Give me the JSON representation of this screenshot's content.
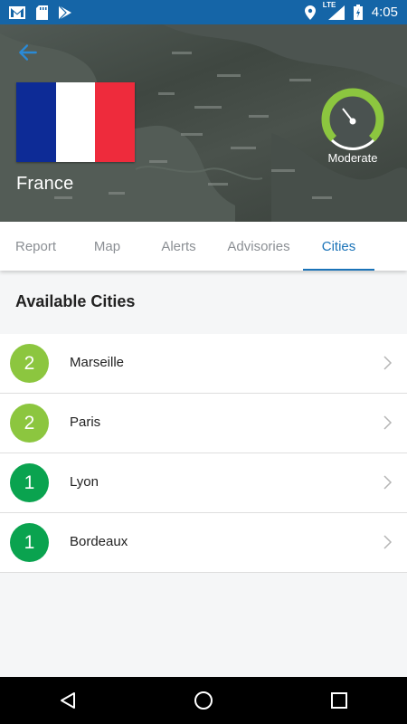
{
  "status_bar": {
    "time": "4:05",
    "network": "LTE",
    "icons": [
      "gmail-icon",
      "sd-card-icon",
      "play-store-icon",
      "location-icon",
      "signal-icon",
      "battery-icon"
    ]
  },
  "header": {
    "country": "France",
    "flag_colors": [
      "#0d2b96",
      "#ffffff",
      "#ee2b3c"
    ],
    "air_quality_label": "Moderate",
    "gauge_color": "#8cc63f"
  },
  "tabs": [
    {
      "label": "Report",
      "active": false
    },
    {
      "label": "Map",
      "active": false
    },
    {
      "label": "Alerts",
      "active": false
    },
    {
      "label": "Advisories",
      "active": false
    },
    {
      "label": "Cities",
      "active": true
    }
  ],
  "section": {
    "title": "Available Cities"
  },
  "cities": [
    {
      "score": "2",
      "name": "Marseille",
      "color": "#8cc63f"
    },
    {
      "score": "2",
      "name": "Paris",
      "color": "#8cc63f"
    },
    {
      "score": "1",
      "name": "Lyon",
      "color": "#0aa34f"
    },
    {
      "score": "1",
      "name": "Bordeaux",
      "color": "#0aa34f"
    }
  ],
  "colors": {
    "accent": "#1a73b8",
    "status_bar": "#1565a7"
  }
}
